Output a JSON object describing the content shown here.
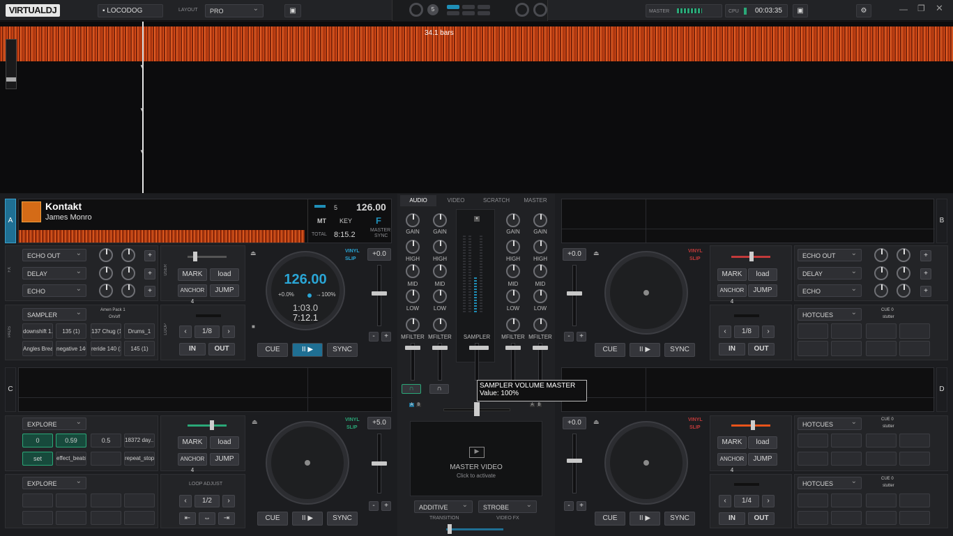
{
  "app": {
    "logo": "VIRTUALDJ",
    "user": "LOCODOG",
    "layout_label": "LAYOUT",
    "layout_value": "PRO",
    "master_label": "MASTER",
    "cpu_label": "CPU",
    "clock": "00:03:35",
    "center_count": "5"
  },
  "waveform": {
    "bars_label": "34.1 bars"
  },
  "deckA": {
    "letter": "A",
    "title": "Kontakt",
    "artist": "James Monro",
    "bpm": "126.00",
    "mt": "MT",
    "key_label": "KEY",
    "key_value": "F",
    "deck_num": "5",
    "total_label": "TOTAL",
    "total_time": "8:15.2",
    "master_label": "MASTER",
    "sync_label": "SYNC",
    "fx": [
      "ECHO OUT",
      "DELAY",
      "ECHO"
    ],
    "fx_tag": "FX",
    "user_tag": "USER",
    "pads_tag": "PADS",
    "loop_tag": "LOOP",
    "mark": "MARK",
    "load": "load",
    "anchor": "ANCHOR 4",
    "jump": "JUMP",
    "platter_bpm": "126.00",
    "pitch": "+0.0%",
    "range": "→100%",
    "elapsed": "1:03.0",
    "remain": "7:12.1",
    "vinyl": "VINYL",
    "slip": "SLIP",
    "pitch_readout": "+0.0",
    "cue": "CUE",
    "play": "II ▶",
    "sync": "SYNC",
    "pads_mode": "SAMPLER",
    "pack": "Amen Pack 1",
    "onoff": "On/off",
    "pads": [
      "downshift 1...",
      "135 (1)",
      "137 Chug (1)",
      "Drums_1",
      "Angles Break",
      "negative 140",
      "reride 140 (1)",
      "145 (1)"
    ],
    "loop_size": "1/8",
    "in": "IN",
    "out": "OUT"
  },
  "deckB": {
    "letter": "B",
    "fx": [
      "ECHO OUT",
      "DELAY",
      "ECHO"
    ],
    "mark": "MARK",
    "load": "load",
    "anchor": "ANCHOR 4",
    "jump": "JUMP",
    "vinyl": "VINYL",
    "slip": "SLIP",
    "pitch_readout": "+0.0",
    "cue": "CUE",
    "play": "II ▶",
    "sync": "SYNC",
    "pads_mode": "HOTCUES",
    "cue_label": "CUE 0",
    "stutter": "stutter",
    "loop_size": "1/8",
    "in": "IN",
    "out": "OUT"
  },
  "deckC": {
    "letter": "C",
    "fx_mode": "EXPLORE",
    "fx_vals": [
      "0",
      "0.59",
      "0.5",
      "18372 day..."
    ],
    "fx_vals2": [
      "set",
      "effect_beats",
      "",
      "repeat_stop"
    ],
    "mark": "MARK",
    "load": "load",
    "anchor": "ANCHOR 4",
    "jump": "JUMP",
    "vinyl": "VINYL",
    "slip": "SLIP",
    "pitch_readout": "+5.0",
    "cue": "CUE",
    "play": "II ▶",
    "sync": "SYNC",
    "pads_mode": "EXPLORE",
    "loop_adjust": "LOOP ADJUST",
    "loop_size": "1/2"
  },
  "deckD": {
    "letter": "D",
    "mark": "MARK",
    "load": "load",
    "anchor": "ANCHOR 4",
    "jump": "JUMP",
    "vinyl": "VINYL",
    "slip": "SLIP",
    "pitch_readout": "+0.0",
    "cue": "CUE",
    "play": "II ▶",
    "sync": "SYNC",
    "pads_mode": "HOTCUES",
    "pads_mode2": "HOTCUES",
    "cue_label": "CUE 0",
    "stutter": "stutter",
    "loop_size": "1/4",
    "in": "IN",
    "out": "OUT"
  },
  "mixer": {
    "tabs": [
      "AUDIO",
      "VIDEO",
      "SCRATCH",
      "MASTER"
    ],
    "gain": "GAIN",
    "high": "HIGH",
    "mid": "MID",
    "low": "LOW",
    "mfilter": "MFILTER",
    "sampler": "SAMPLER",
    "tooltip_title": "SAMPLER VOLUME MASTER",
    "tooltip_value": "Value: 100%",
    "video_title": "MASTER VIDEO",
    "video_sub": "Click to activate",
    "transition_mode": "ADDITIVE",
    "videofx_mode": "STROBE",
    "transition_label": "TRANSITION",
    "videofx_label": "VIDEO FX"
  },
  "colors": {
    "accent": "#1f8fb8",
    "orange": "#e8531a",
    "red": "#c23a3a",
    "green": "#2aa878"
  }
}
